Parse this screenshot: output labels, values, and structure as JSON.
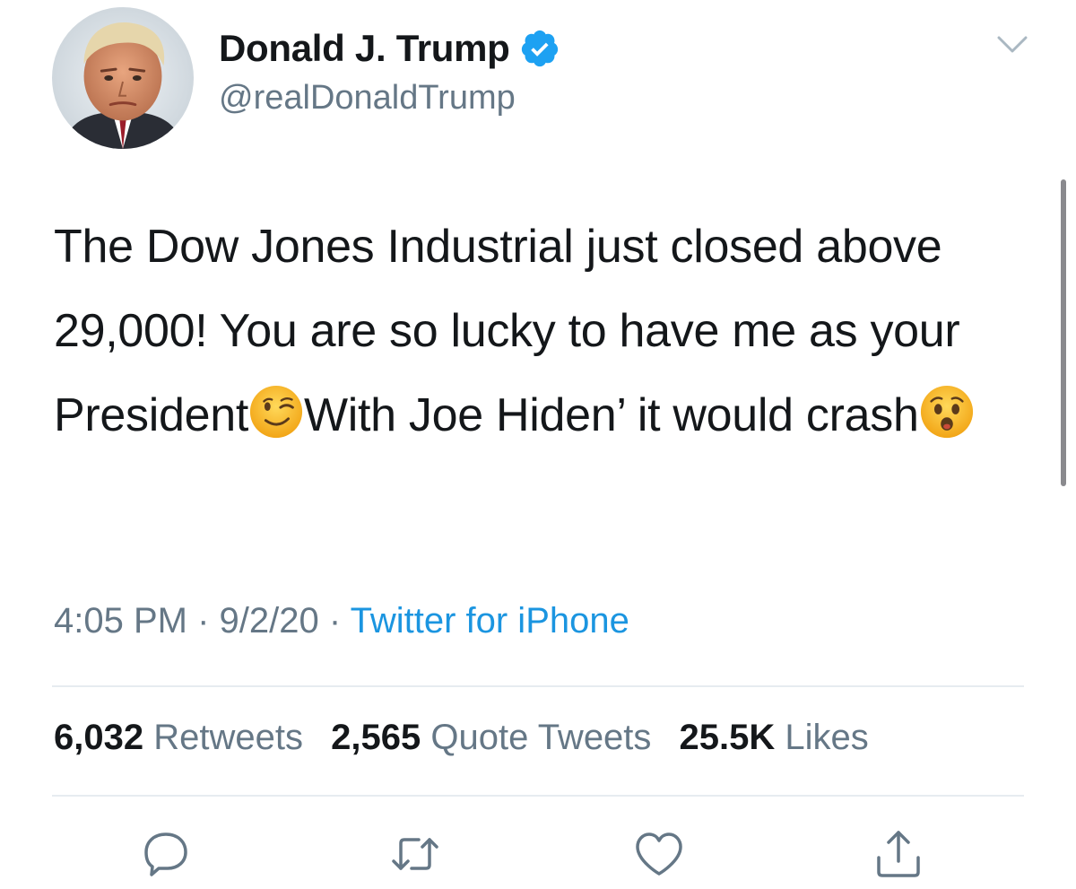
{
  "user": {
    "display_name": "Donald J. Trump",
    "handle": "@realDonaldTrump",
    "avatar_icon": "profile-photo",
    "verified_icon": "verified-badge-icon"
  },
  "tweet": {
    "text_parts": [
      "The Dow Jones Industrial just closed above 29,000! You are so lucky to have me as your President",
      "With Joe Hiden’ it would crash"
    ],
    "emojis": [
      "winking-face-emoji",
      "hushed-face-emoji"
    ]
  },
  "meta": {
    "time": "4:05 PM",
    "separator": "·",
    "date": "9/2/20",
    "source": "Twitter for iPhone"
  },
  "stats": {
    "retweets_count": "6,032",
    "retweets_label": "Retweets",
    "quotes_count": "2,565",
    "quotes_label": "Quote Tweets",
    "likes_count": "25.5K",
    "likes_label": "Likes"
  },
  "actions": [
    "reply-icon",
    "retweet-icon",
    "like-icon",
    "share-icon"
  ],
  "colors": {
    "text": "#14171a",
    "secondary": "#657786",
    "link": "#1b95e0",
    "verified": "#1da1f2",
    "divider": "#e6ecf0"
  }
}
